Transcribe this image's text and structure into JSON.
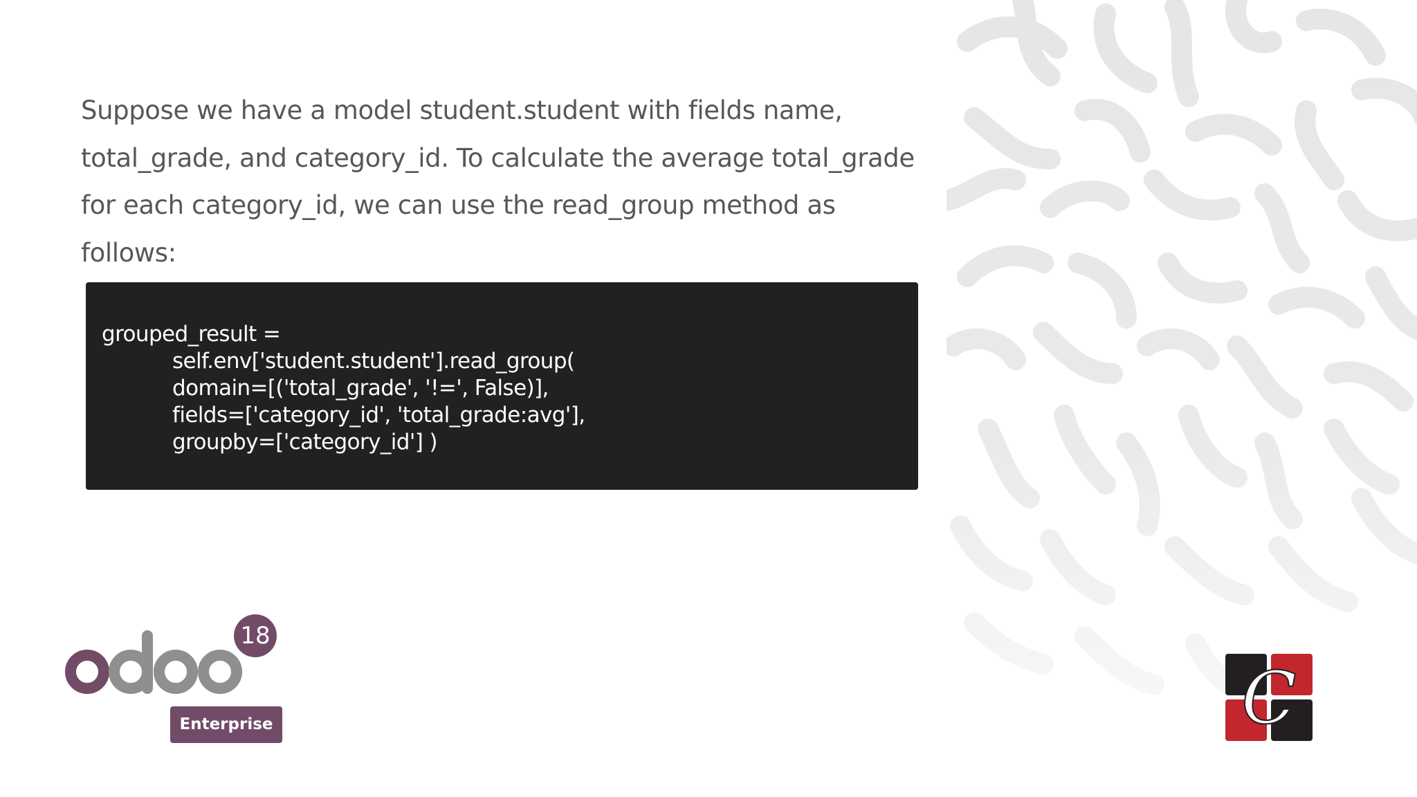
{
  "slide": {
    "intro_text": "Suppose we have a model student.student with fields name, total_grade, and category_id. To calculate the average total_grade for each category_id, we can use the read_group method as follows:",
    "code_lines": [
      "grouped_result =",
      "self.env['student.student'].read_group(",
      "domain=[('total_grade', '!=', False)],",
      "fields=['category_id', 'total_grade:avg'],",
      "groupby=['category_id'] )"
    ]
  },
  "footer": {
    "odoo_version": "18",
    "edition_label": "Enterprise",
    "brand_logo_icon": "cybrosys-logo-icon",
    "odoo_logo_icon": "odoo-logo-icon"
  },
  "colors": {
    "odoo_purple": "#714b67",
    "odoo_grey": "#8f8f8f",
    "code_background": "#212121",
    "brand_red": "#c1272d",
    "brand_dark": "#231f20"
  }
}
